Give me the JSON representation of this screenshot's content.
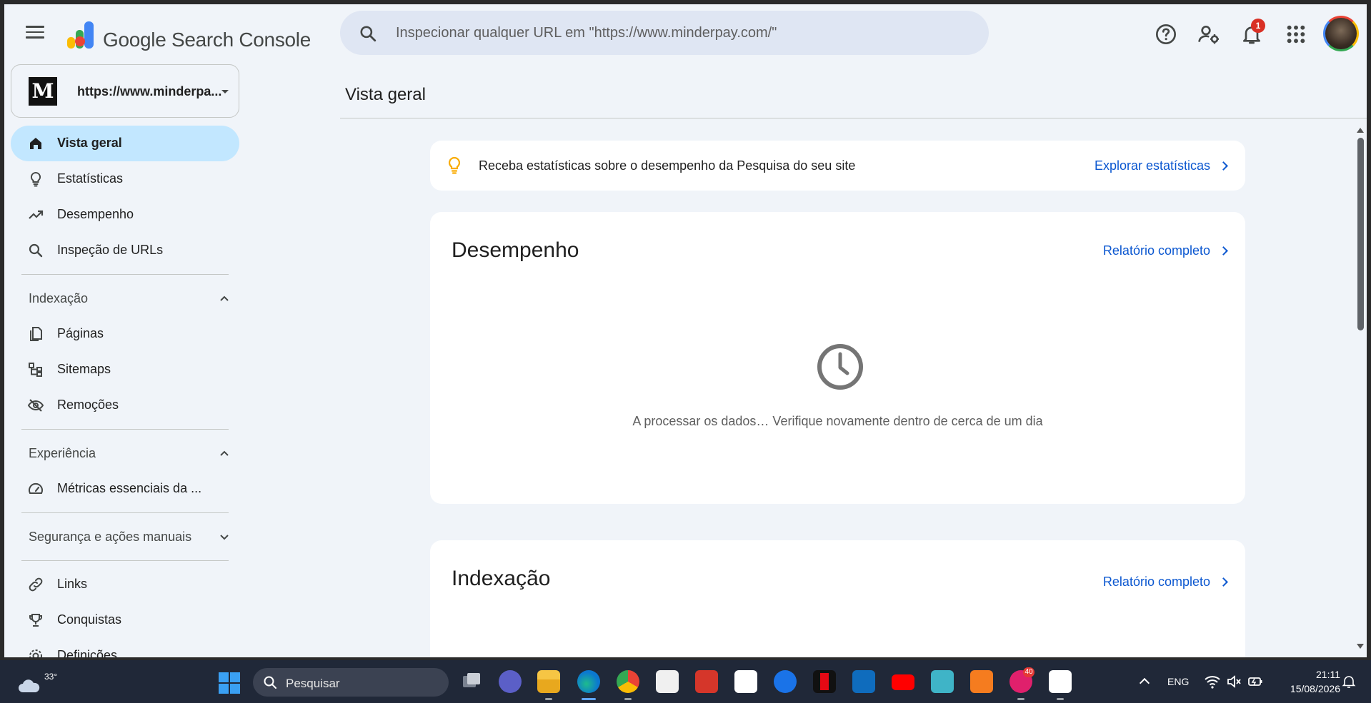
{
  "header": {
    "product_name": "Google Search Console",
    "search_placeholder": "Inspecionar qualquer URL em \"https://www.minderpay.com/\"",
    "notification_count": "1"
  },
  "property": {
    "logo_letter": "M",
    "url": "https://www.minderpa..."
  },
  "sidebar": {
    "items": [
      {
        "label": "Vista geral",
        "icon": "home-icon"
      },
      {
        "label": "Estatísticas",
        "icon": "lightbulb-icon"
      },
      {
        "label": "Desempenho",
        "icon": "trending-up-icon"
      },
      {
        "label": "Inspeção de URLs",
        "icon": "search-icon"
      }
    ],
    "indexing": {
      "label": "Indexação",
      "items": [
        {
          "label": "Páginas",
          "icon": "pages-icon"
        },
        {
          "label": "Sitemaps",
          "icon": "sitemap-icon"
        },
        {
          "label": "Remoções",
          "icon": "eye-off-icon"
        }
      ]
    },
    "experience": {
      "label": "Experiência",
      "items": [
        {
          "label": "Métricas essenciais da ...",
          "icon": "speedometer-icon"
        }
      ]
    },
    "security": {
      "label": "Segurança e ações manuais"
    },
    "bottom_items": [
      {
        "label": "Links",
        "icon": "link-icon"
      },
      {
        "label": "Conquistas",
        "icon": "trophy-icon"
      },
      {
        "label": "Definições",
        "icon": "settings-icon"
      }
    ]
  },
  "main": {
    "page_title": "Vista geral",
    "insights": {
      "text": "Receba estatísticas sobre o desempenho da Pesquisa do seu site",
      "link": "Explorar estatísticas"
    },
    "performance": {
      "title": "Desempenho",
      "link": "Relatório completo",
      "processing_text": "A processar os dados… Verifique novamente dentro de cerca de um dia"
    },
    "indexing": {
      "title": "Indexação",
      "link": "Relatório completo"
    }
  },
  "taskbar": {
    "weather_temp": "33°",
    "search_label": "Pesquisar",
    "whatsapp_badge": "40",
    "language": "ENG",
    "time": "21:11",
    "date": "15/08/2026"
  },
  "colors": {
    "accent": "#0b57d0",
    "active_nav": "#c2e7ff",
    "page_bg": "#f0f4f9",
    "badge": "#d93025"
  }
}
